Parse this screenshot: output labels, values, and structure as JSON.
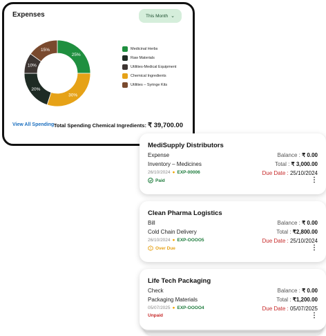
{
  "expenses": {
    "title": "Expenses",
    "period_label": "This Month",
    "view_all": "View All Spending",
    "total_label": "Total Spending Chemical Ingredients:",
    "total_value": "₹ 39,700.00"
  },
  "chart_data": {
    "type": "pie",
    "categories": [
      "Medicinal Herbs",
      "Raw Materials",
      "Utilities-Medical Equipment",
      "Chemical Ingredients",
      "Utilities – Syringe Kits"
    ],
    "values": [
      25,
      20,
      10,
      30,
      15
    ],
    "labels": [
      "25%",
      "20%",
      "10%",
      "30%",
      "15%"
    ],
    "colors": [
      "#1f8f3f",
      "#1e2b24",
      "#3d3532",
      "#e6a217",
      "#7a4a2e"
    ],
    "display_order": [
      0,
      3,
      1,
      2,
      4
    ]
  },
  "ledgers": [
    {
      "name": "MediSupply Distributors",
      "type": "Expense",
      "category": "Inventory – Medicines",
      "date": "26/10/2024",
      "code": "EXP-00006",
      "status": "Paid",
      "status_color": "#1b7a3a",
      "balance_label": "Balance :",
      "balance": "₹ 0.00",
      "total_label": "Total :",
      "total": "₹ 3,000.00",
      "due_label": "Due Date :",
      "due": "25/10/2024"
    },
    {
      "name": "Clean Pharma Logistics",
      "type": "Bill",
      "category": "Cold Chain Delivery",
      "date": "26/10/2024",
      "code": "EXP-OOOO5",
      "status": "Over Due",
      "status_color": "#e6a217",
      "balance_label": "Balance :",
      "balance": "₹ 0.00",
      "total_label": "Total :",
      "total": "₹2,800.00",
      "due_label": "Due Date :",
      "due": "25/10/2024"
    },
    {
      "name": "Life Tech Packaging",
      "type": "Check",
      "category": "Packaging Materials",
      "date": "05/07/2025",
      "code": "EXP-OOOO4",
      "status": "Unpaid",
      "status_color": "#c62828",
      "balance_label": "Balance :",
      "balance": "₹ 0.00",
      "total_label": "Total :",
      "total": "₹1,200.00",
      "due_label": "Due Date :",
      "due": "05/07/2025"
    }
  ]
}
